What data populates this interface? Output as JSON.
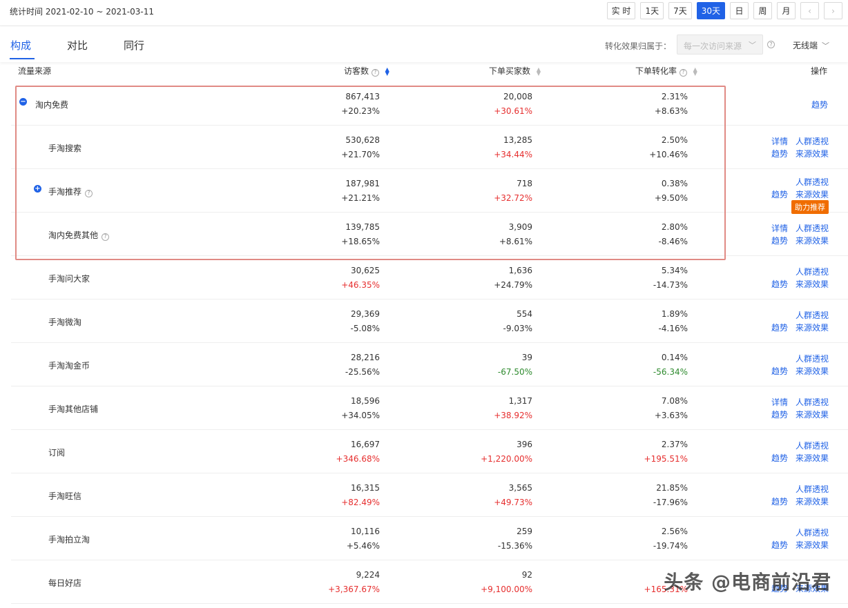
{
  "header": {
    "stat_time": "统计时间 2021-02-10 ~ 2021-03-11",
    "range_buttons": [
      "实 时",
      "1天",
      "7天",
      "30天",
      "日",
      "周",
      "月"
    ],
    "active_range": "30天",
    "prev_icon": "chevron-left-icon",
    "next_icon": "chevron-right-icon"
  },
  "tabs": {
    "items": [
      "构成",
      "对比",
      "同行"
    ],
    "active": "构成"
  },
  "attribution": {
    "label": "转化效果归属于：",
    "select_value": "每一次访问来源",
    "device": "无线端"
  },
  "table": {
    "headers": {
      "source": "流量来源",
      "visitors": "访客数",
      "buyers": "下单买家数",
      "rate": "下单转化率",
      "ops": "操作"
    },
    "rows": [
      {
        "name": "淘内免费",
        "visitors": "867,413",
        "visitors_chg": "+20.23%",
        "buyers": "20,008",
        "buyers_chg": "+30.61%",
        "rate": "2.31%",
        "rate_chg": "+8.63%",
        "ops": [
          "趋势"
        ]
      },
      {
        "name": "手淘搜索",
        "visitors": "530,628",
        "visitors_chg": "+21.70%",
        "buyers": "13,285",
        "buyers_chg": "+34.44%",
        "rate": "2.50%",
        "rate_chg": "+10.46%",
        "ops": [
          "详情",
          "人群透视",
          "趋势",
          "来源效果"
        ]
      },
      {
        "name": "手淘推荐",
        "visitors": "187,981",
        "visitors_chg": "+21.21%",
        "buyers": "718",
        "buyers_chg": "+32.72%",
        "rate": "0.38%",
        "rate_chg": "+9.50%",
        "ops": [
          "人群透视",
          "趋势",
          "来源效果"
        ],
        "badge": "助力推荐"
      },
      {
        "name": "淘内免费其他",
        "visitors": "139,785",
        "visitors_chg": "+18.65%",
        "buyers": "3,909",
        "buyers_chg": "+8.61%",
        "rate": "2.80%",
        "rate_chg": "-8.46%",
        "ops": [
          "详情",
          "人群透视",
          "趋势",
          "来源效果"
        ]
      },
      {
        "name": "手淘问大家",
        "visitors": "30,625",
        "visitors_chg": "+46.35%",
        "buyers": "1,636",
        "buyers_chg": "+24.79%",
        "rate": "5.34%",
        "rate_chg": "-14.73%",
        "ops": [
          "人群透视",
          "趋势",
          "来源效果"
        ]
      },
      {
        "name": "手淘微淘",
        "visitors": "29,369",
        "visitors_chg": "-5.08%",
        "buyers": "554",
        "buyers_chg": "-9.03%",
        "rate": "1.89%",
        "rate_chg": "-4.16%",
        "ops": [
          "人群透视",
          "趋势",
          "来源效果"
        ]
      },
      {
        "name": "手淘淘金币",
        "visitors": "28,216",
        "visitors_chg": "-25.56%",
        "buyers": "39",
        "buyers_chg": "-67.50%",
        "rate": "0.14%",
        "rate_chg": "-56.34%",
        "ops": [
          "人群透视",
          "趋势",
          "来源效果"
        ]
      },
      {
        "name": "手淘其他店铺",
        "visitors": "18,596",
        "visitors_chg": "+34.05%",
        "buyers": "1,317",
        "buyers_chg": "+38.92%",
        "rate": "7.08%",
        "rate_chg": "+3.63%",
        "ops": [
          "详情",
          "人群透视",
          "趋势",
          "来源效果"
        ]
      },
      {
        "name": "订阅",
        "visitors": "16,697",
        "visitors_chg": "+346.68%",
        "buyers": "396",
        "buyers_chg": "+1,220.00%",
        "rate": "2.37%",
        "rate_chg": "+195.51%",
        "ops": [
          "人群透视",
          "趋势",
          "来源效果"
        ]
      },
      {
        "name": "手淘旺信",
        "visitors": "16,315",
        "visitors_chg": "+82.49%",
        "buyers": "3,565",
        "buyers_chg": "+49.73%",
        "rate": "21.85%",
        "rate_chg": "-17.96%",
        "ops": [
          "人群透视",
          "趋势",
          "来源效果"
        ]
      },
      {
        "name": "手淘拍立淘",
        "visitors": "10,116",
        "visitors_chg": "+5.46%",
        "buyers": "259",
        "buyers_chg": "-15.36%",
        "rate": "2.56%",
        "rate_chg": "-19.74%",
        "ops": [
          "人群透视",
          "趋势",
          "来源效果"
        ]
      },
      {
        "name": "每日好店",
        "visitors": "9,224",
        "visitors_chg": "+3,367.67%",
        "buyers": "92",
        "buyers_chg": "+9,100.00%",
        "rate": "",
        "rate_chg": "+165.31%",
        "ops": [
          "趋势",
          "来源效果"
        ]
      }
    ]
  },
  "colors": {
    "accent": "#2062e6",
    "increase": "#e62e2e",
    "decrease": "#2e8a2e",
    "highlight_border": "#e08a84",
    "badge": "#f06d00"
  },
  "watermark": "头条 @电商前沿君"
}
